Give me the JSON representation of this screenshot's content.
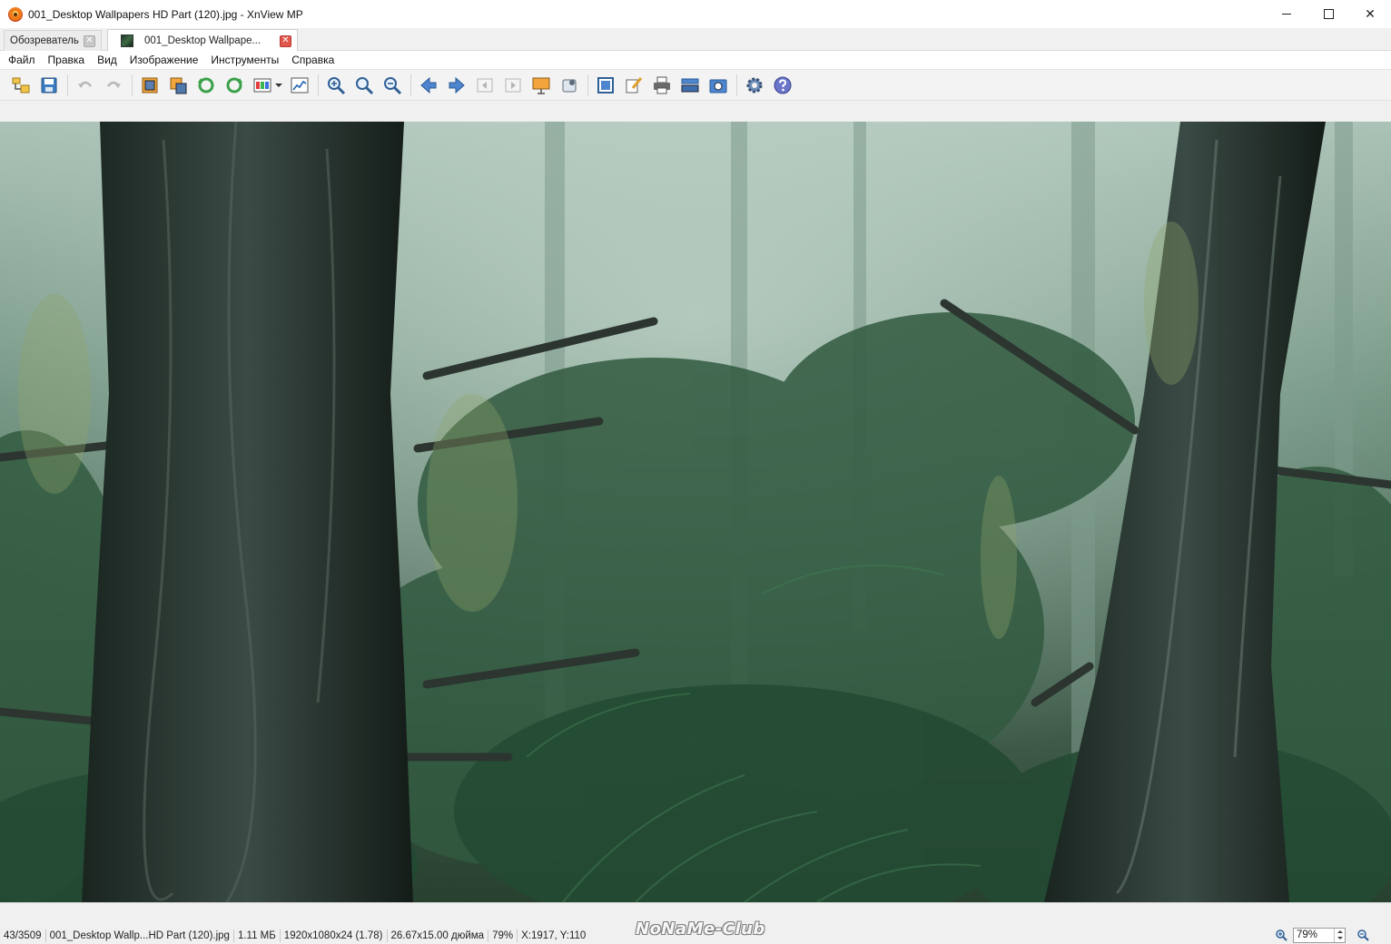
{
  "window": {
    "title": "001_Desktop Wallpapers  HD Part (120).jpg - XnView MP",
    "controls": {
      "minimize": "",
      "maximize": "",
      "close": "✕"
    }
  },
  "tabs": [
    {
      "label": "Обозреватель",
      "close": "✕"
    },
    {
      "label": "001_Desktop Wallpape...",
      "close": "✕"
    }
  ],
  "menu": [
    "Файл",
    "Правка",
    "Вид",
    "Изображение",
    "Инструменты",
    "Справка"
  ],
  "toolbar": {
    "icons": [
      "browser-icon",
      "save-icon",
      "undo-icon",
      "redo-icon",
      "crop-icon",
      "resize-icon",
      "rotate-left-icon",
      "rotate-right-icon",
      "adjust-colors-icon",
      "levels-icon",
      "zoom-in-icon",
      "zoom-100-icon",
      "zoom-out-icon",
      "previous-icon",
      "next-icon",
      "first-page-icon",
      "last-page-icon",
      "slideshow-icon",
      "fullscreen-icon",
      "fit-window-icon",
      "edit-icon",
      "print-icon",
      "scan-icon",
      "capture-icon",
      "settings-icon",
      "help-icon"
    ]
  },
  "status": {
    "index": "43/3509",
    "filename": "001_Desktop Wallp...HD Part (120).jpg",
    "filesize": "1.11 МБ",
    "dimensions": "1920x1080x24 (1.78)",
    "print_size": "26.67x15.00 дюйма",
    "zoom": "79%",
    "coords": "X:1917, Y:110",
    "watermark": "NoNaMe-Club",
    "zoom_field": "79%"
  },
  "colors": {
    "accent_orange": "#f07b1a",
    "tab_close_red": "#e2574c",
    "forest_dark": "#1f3527",
    "forest_mid": "#3f6a52",
    "fog": "#9fb8ae"
  }
}
